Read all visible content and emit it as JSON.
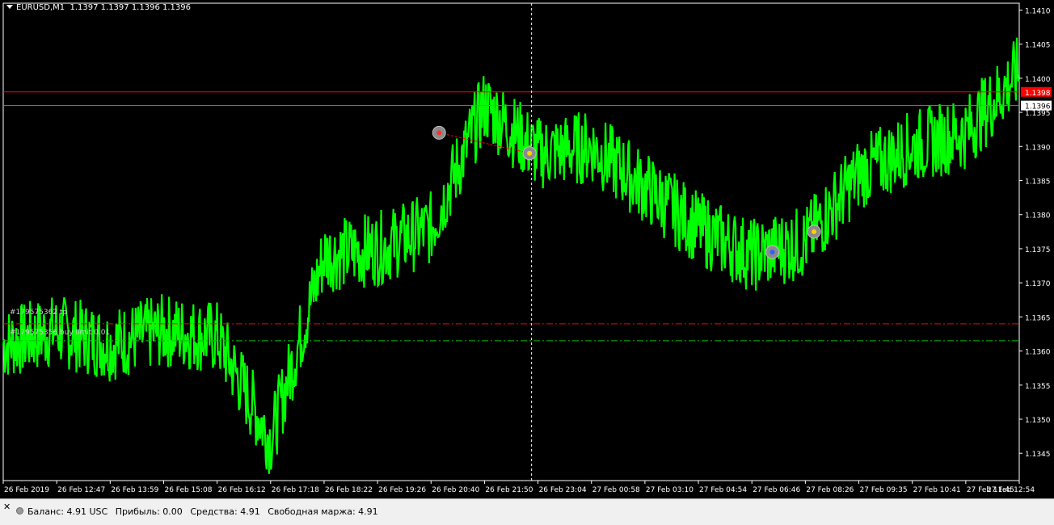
{
  "chart": {
    "symbol_title": "EURUSD,M1",
    "ohlc_text": "1.1397 1.1397 1.1396 1.1396",
    "price_ticks": [
      "1.1410",
      "1.1405",
      "1.1400",
      "1.1395",
      "1.1390",
      "1.1385",
      "1.1380",
      "1.1375",
      "1.1370",
      "1.1365",
      "1.1360",
      "1.1355",
      "1.1350",
      "1.1345"
    ],
    "time_ticks": [
      "26 Feb 2019",
      "26 Feb 12:47",
      "26 Feb 13:59",
      "26 Feb 15:08",
      "26 Feb 16:12",
      "26 Feb 17:18",
      "26 Feb 18:22",
      "26 Feb 19:26",
      "26 Feb 20:40",
      "26 Feb 21:50",
      "26 Feb 23:04",
      "27 Feb 00:58",
      "27 Feb 03:10",
      "27 Feb 04:54",
      "27 Feb 06:46",
      "27 Feb 08:26",
      "27 Feb 09:35",
      "27 Feb 10:41",
      "27 Feb 11:45",
      "27 Feb 12:54"
    ],
    "ask_price_label": "1.1398",
    "bid_price_label": "1.1396",
    "order_labels": {
      "tp_label": "#179575362 tp",
      "buy_limit_label": "#179575356 buy limit 0.01"
    },
    "colors": {
      "background": "#000000",
      "candles": "#00ff00",
      "ask_line": "#ff0000",
      "bid_line": "#808080",
      "tp_line": "#ff0000",
      "pending_line": "#00c000",
      "crosshair": "#ffffff",
      "axis_text": "#ffffff"
    }
  },
  "status_bar": {
    "balance": "Баланс: 4.91 USC",
    "profit": "Прибыль: 0.00",
    "equity": "Средства: 4.91",
    "free_margin": "Свободная маржа: 4.91"
  },
  "chart_data": {
    "type": "line",
    "title": "EURUSD,M1",
    "ylim": [
      1.1341,
      1.1411
    ],
    "x": [
      "26 Feb 2019",
      "26 Feb 12:47",
      "26 Feb 13:59",
      "26 Feb 15:08",
      "26 Feb 16:12",
      "26 Feb 17:18",
      "26 Feb 18:22",
      "26 Feb 19:26",
      "26 Feb 20:40",
      "26 Feb 21:50",
      "26 Feb 23:04",
      "27 Feb 00:58",
      "27 Feb 03:10",
      "27 Feb 04:54",
      "27 Feb 06:46",
      "27 Feb 08:26",
      "27 Feb 09:35",
      "27 Feb 10:41",
      "27 Feb 11:45",
      "27 Feb 12:54"
    ],
    "series": [
      {
        "values": [
          1.1361,
          1.1363,
          1.1361,
          1.1363,
          1.1362,
          1.1347,
          1.1374,
          1.1375,
          1.1378,
          1.1396,
          1.1389,
          1.139,
          1.1384,
          1.1378,
          1.1374,
          1.1376,
          1.1386,
          1.139,
          1.1392,
          1.1401
        ]
      }
    ],
    "horizontal_lines": {
      "ask": 1.1398,
      "bid": 1.1396,
      "take_profit": 1.1364,
      "buy_limit": 1.13615
    },
    "grid": false
  }
}
